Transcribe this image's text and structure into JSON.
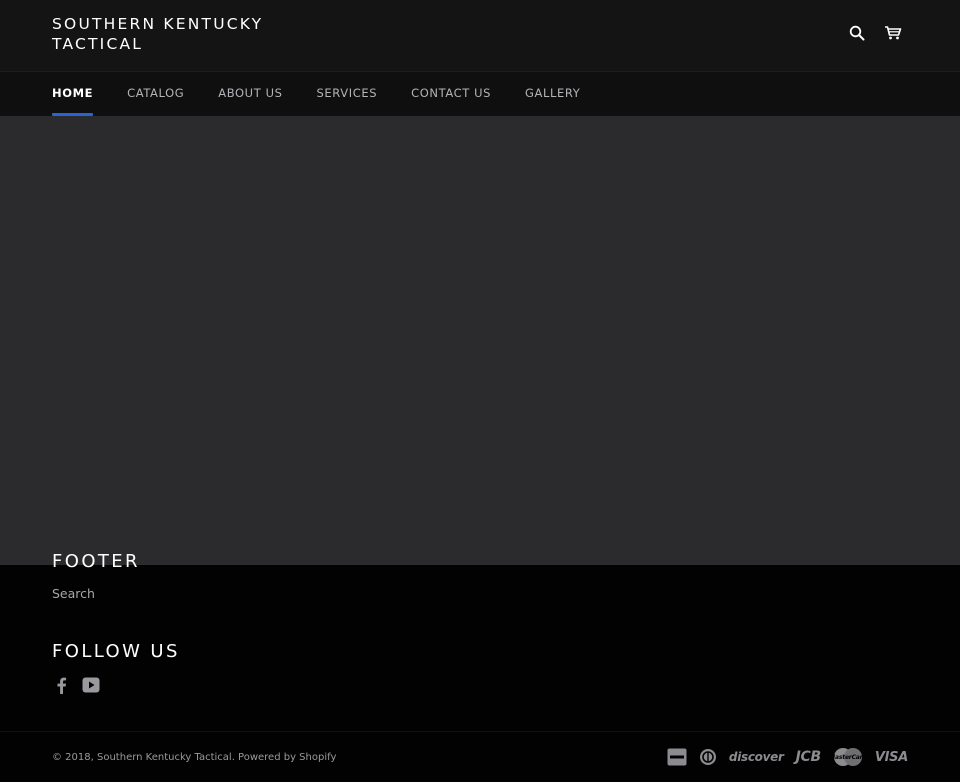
{
  "header": {
    "logo_text": "SOUTHERN KENTUCKY TACTICAL",
    "search_icon": "search-icon",
    "cart_icon": "cart-icon"
  },
  "nav": {
    "items": [
      {
        "label": "HOME",
        "active": true
      },
      {
        "label": "CATALOG",
        "active": false
      },
      {
        "label": "ABOUT US",
        "active": false
      },
      {
        "label": "SERVICES",
        "active": false
      },
      {
        "label": "CONTACT US",
        "active": false
      },
      {
        "label": "GALLERY",
        "active": false
      }
    ],
    "accent_color": "#2a63d6"
  },
  "footer": {
    "footer_heading": "FOOTER",
    "search_link": "Search",
    "follow_heading": "FOLLOW US",
    "social_icons": [
      "facebook-icon",
      "youtube-icon"
    ],
    "copyright_prefix": "© 2018, ",
    "copyright_store": "Southern Kentucky Tactical",
    "copyright_suffix": ". Powered by Shopify",
    "payment_icons": [
      {
        "name": "amex-icon"
      },
      {
        "name": "diners-club-icon"
      },
      {
        "name": "discover-icon",
        "label": "discover"
      },
      {
        "name": "jcb-icon",
        "label": "JCB"
      },
      {
        "name": "mastercard-icon",
        "label": "MasterCard"
      },
      {
        "name": "visa-icon",
        "label": "VISA"
      }
    ]
  },
  "colors": {
    "header_bg": "#141414",
    "nav_bg": "#0f0f10",
    "main_bg": "#2b2b2e",
    "footer_bg": "#020202"
  }
}
